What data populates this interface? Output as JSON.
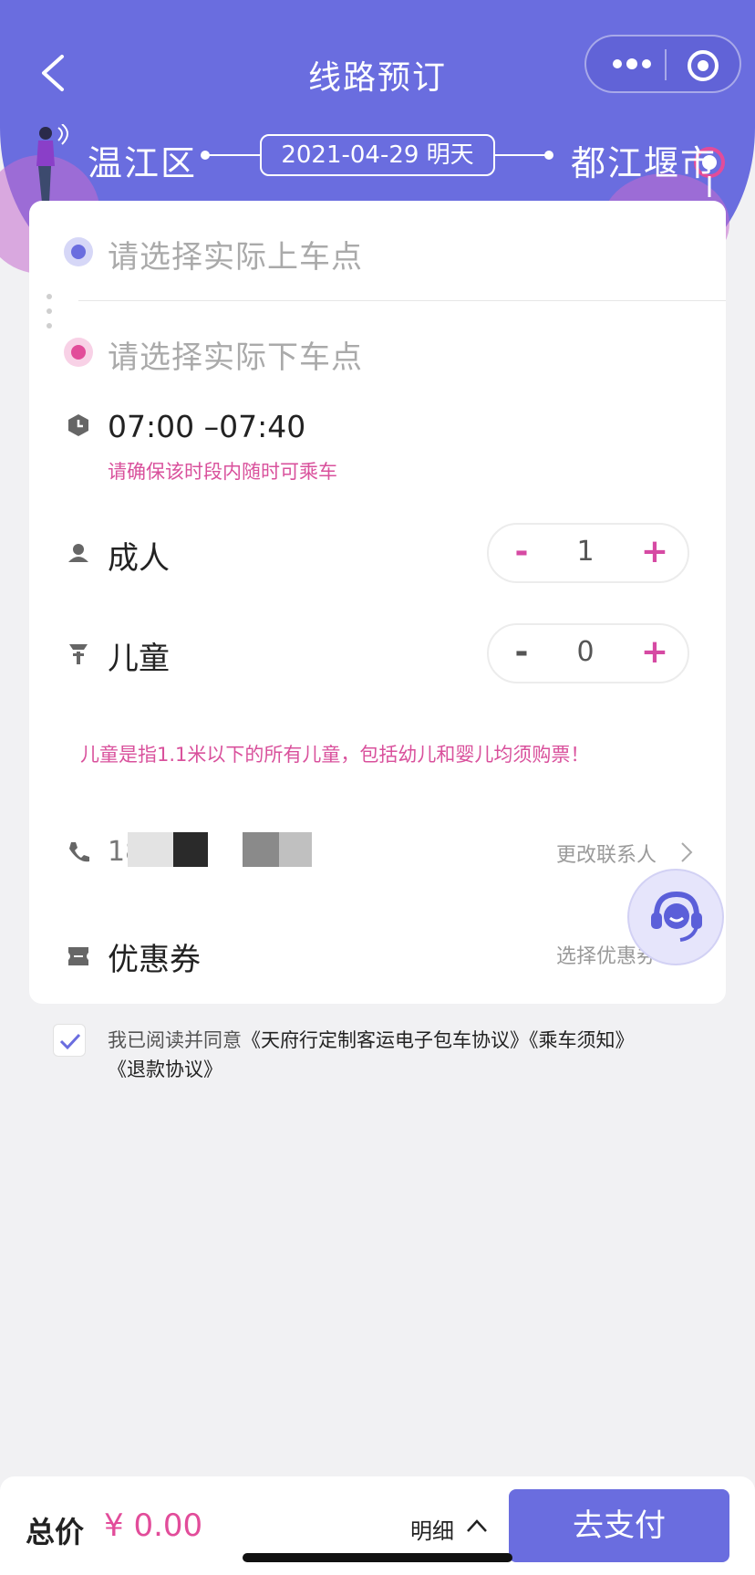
{
  "nav": {
    "title": "线路预订"
  },
  "route": {
    "from": "温江区",
    "to": "都江堰市",
    "date": "2021-04-29 明天"
  },
  "stops": {
    "pickup_placeholder": "请选择实际上车点",
    "dropoff_placeholder": "请选择实际下车点"
  },
  "time": {
    "range": "07:00 –07:40",
    "note": "请确保该时段内随时可乘车"
  },
  "passengers": {
    "adult": {
      "label": "成人",
      "count": "1",
      "minus": "-",
      "plus": "+"
    },
    "child": {
      "label": "儿童",
      "count": "0",
      "minus": "-",
      "plus": "+"
    },
    "child_note": "儿童是指1.1米以下的所有儿童，包括幼儿和婴儿均须购票！"
  },
  "contact": {
    "phone_visible_prefix": "18",
    "change_label": "更改联系人"
  },
  "coupon": {
    "label": "优惠券",
    "select_label": "选择优惠券"
  },
  "agreement": {
    "prefix": "我已阅读并同意",
    "link1": "《天府行定制客运电子包车协议》",
    "link2": "《乘车须知》",
    "link3": "《退款协议》",
    "checked": true
  },
  "footer": {
    "total_label": "总价",
    "total_value": "¥ 0.00",
    "detail_label": "明细",
    "pay_label": "去支付"
  },
  "colors": {
    "primary": "#6a6ddf",
    "accent_pink": "#e24c9a",
    "note_pink": "#d9519c",
    "background": "#f1f1f3"
  }
}
